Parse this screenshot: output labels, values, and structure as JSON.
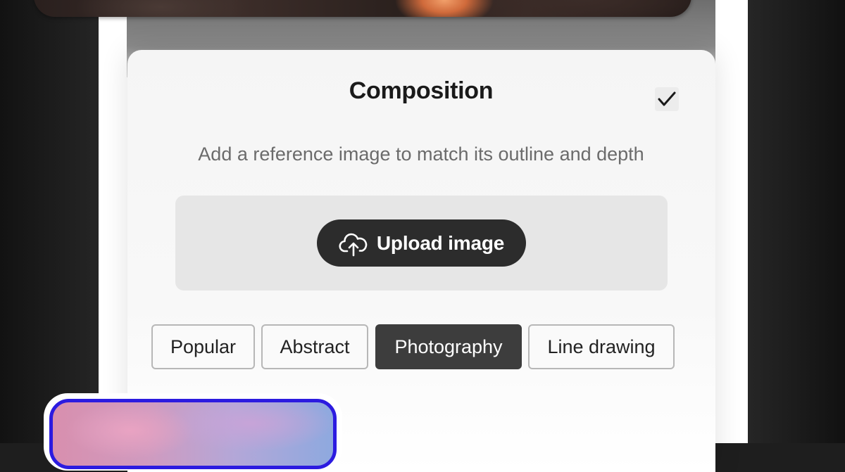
{
  "composition_panel": {
    "title": "Composition",
    "subtitle": "Add a reference image to match its outline and depth",
    "upload_button": {
      "label": "Upload image",
      "icon": "cloud-upload-icon"
    },
    "confirm_icon": "checkmark-icon"
  },
  "style_filters": [
    {
      "label": "Popular",
      "selected": false
    },
    {
      "label": "Abstract",
      "selected": false
    },
    {
      "label": "Photography",
      "selected": true
    },
    {
      "label": "Line drawing",
      "selected": false
    }
  ],
  "colors": {
    "upload_button_bg": "#2c2c2c",
    "selected_chip_bg": "#3d3d3d",
    "thumbnail_border": "#2c1be0",
    "dropzone_bg": "#e6e6e6"
  }
}
